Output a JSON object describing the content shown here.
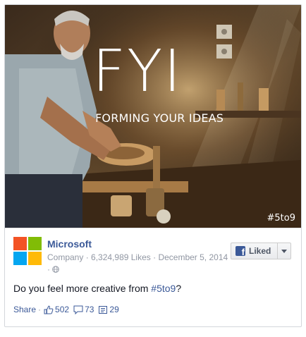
{
  "post": {
    "image": {
      "title": "FYI",
      "subtitle": "FORMING YOUR IDEAS",
      "hashtag": "#5to9"
    },
    "page": {
      "name": "Microsoft",
      "category": "Company",
      "likes_text": "6,324,989 Likes",
      "date": "December 5, 2014",
      "separator": " · ",
      "logo_colors": [
        "#f35325",
        "#81bc06",
        "#05a6f0",
        "#ffba08"
      ]
    },
    "liked_button": {
      "label": "Liked"
    },
    "message": {
      "text_before": "Do you feel more creative from ",
      "hashtag": "#5to9",
      "text_after": "?"
    },
    "actions": {
      "share_label": "Share",
      "likes": "502",
      "comments": "73",
      "shares": "29"
    }
  }
}
